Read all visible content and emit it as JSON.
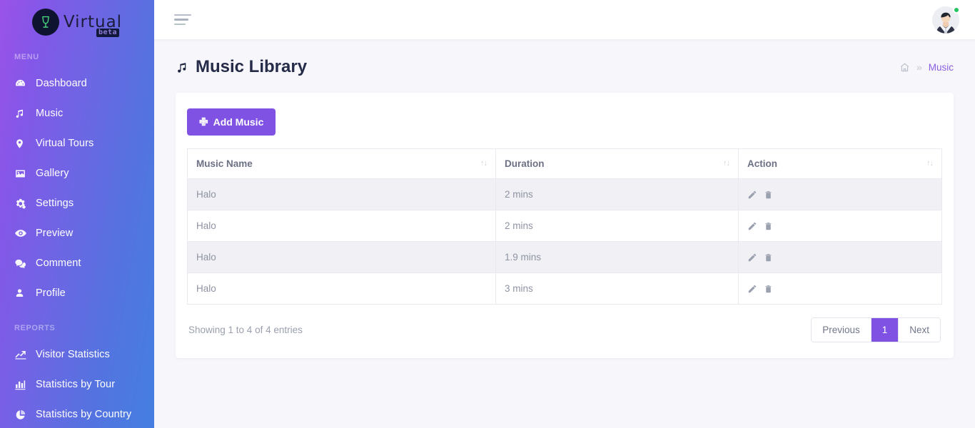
{
  "brand": {
    "name": "Virtual",
    "sub": "beta",
    "logo_icon": "wine-glass-icon"
  },
  "sidebar": {
    "sections": [
      {
        "label": "MENU",
        "items": [
          {
            "label": "Dashboard",
            "icon": "dashboard-icon"
          },
          {
            "label": "Music",
            "icon": "music-note-icon"
          },
          {
            "label": "Virtual Tours",
            "icon": "map-pin-icon"
          },
          {
            "label": "Gallery",
            "icon": "image-icon"
          },
          {
            "label": "Settings",
            "icon": "gears-icon"
          },
          {
            "label": "Preview",
            "icon": "eye-icon"
          },
          {
            "label": "Comment",
            "icon": "comment-icon"
          },
          {
            "label": "Profile",
            "icon": "user-icon"
          }
        ]
      },
      {
        "label": "REPORTS",
        "items": [
          {
            "label": "Visitor Statistics",
            "icon": "line-chart-icon"
          },
          {
            "label": "Statistics by Tour",
            "icon": "bar-chart-icon"
          },
          {
            "label": "Statistics by Country",
            "icon": "pie-chart-icon"
          }
        ]
      }
    ]
  },
  "topbar": {
    "menu_toggle_icon": "hamburger-icon",
    "avatar_icon": "user-avatar",
    "status": "online"
  },
  "page": {
    "title": "Music Library",
    "title_icon": "music-note-icon",
    "breadcrumb": {
      "home_icon": "home-icon",
      "separator": "»",
      "current": "Music"
    }
  },
  "toolbar": {
    "add_label": "Add Music",
    "add_icon": "plus-icon"
  },
  "table": {
    "columns": [
      {
        "label": "Music Name",
        "sortable": true
      },
      {
        "label": "Duration",
        "sortable": true
      },
      {
        "label": "Action",
        "sortable": true
      }
    ],
    "sort_glyph": "↑↓",
    "rows": [
      {
        "name": "Halo",
        "duration": "2 mins"
      },
      {
        "name": "Halo",
        "duration": "2 mins"
      },
      {
        "name": "Halo",
        "duration": "1.9 mins"
      },
      {
        "name": "Halo",
        "duration": "3 mins"
      }
    ],
    "row_actions": [
      {
        "name": "edit-icon",
        "title": "Edit"
      },
      {
        "name": "delete-icon",
        "title": "Delete"
      }
    ]
  },
  "footer": {
    "entries_info": "Showing 1 to 4 of 4 entries",
    "pagination": {
      "previous": "Previous",
      "pages": [
        "1"
      ],
      "next": "Next",
      "active_page": "1"
    }
  },
  "colors": {
    "accent": "#7f52e3",
    "sidebar_start": "#9b53e8",
    "sidebar_end": "#447fe0",
    "status_online": "#22c55e",
    "page_bg": "#f7f7fb"
  }
}
